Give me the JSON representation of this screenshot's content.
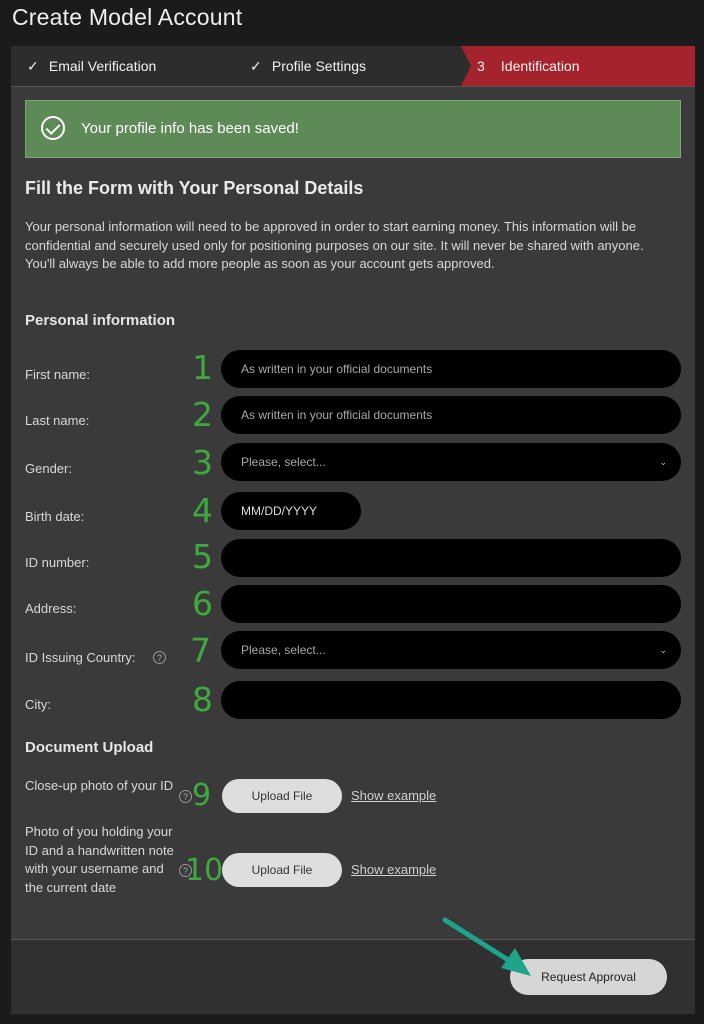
{
  "page_title": "Create Model Account",
  "steps": [
    {
      "label": "Email Verification",
      "status": "done",
      "number": ""
    },
    {
      "label": "Profile Settings",
      "status": "done",
      "number": ""
    },
    {
      "label": "Identification",
      "status": "active",
      "number": "3"
    }
  ],
  "alert": {
    "text": "Your profile info has been saved!"
  },
  "form": {
    "title": "Fill the Form with Your Personal Details",
    "desc_1": "Your personal information will need to be approved in order to start earning money. This information will be confidential and securely used only for positioning purposes on our site. It will never be shared with anyone.",
    "desc_2": "You'll always be able to add more people as soon as your account gets approved."
  },
  "personal": {
    "title": "Personal information",
    "first_name": {
      "label": "First name:",
      "placeholder": "As written in your official documents",
      "num": "1"
    },
    "last_name": {
      "label": "Last name:",
      "placeholder": "As written in your official documents",
      "num": "2"
    },
    "gender": {
      "label": "Gender:",
      "value": "Please, select...",
      "num": "3"
    },
    "birth_date": {
      "label": "Birth date:",
      "placeholder": "MM/DD/YYYY",
      "num": "4"
    },
    "id_number": {
      "label": "ID number:",
      "num": "5"
    },
    "address": {
      "label": "Address:",
      "num": "6"
    },
    "id_country": {
      "label": "ID Issuing Country:",
      "value": "Please, select...",
      "num": "7"
    },
    "city": {
      "label": "City:",
      "num": "8"
    }
  },
  "documents": {
    "title": "Document Upload",
    "closeup": {
      "label": "Close-up photo of your ID",
      "num": "9",
      "button": "Upload File",
      "example": "Show example"
    },
    "holding": {
      "label": "Photo of you holding your ID and a handwritten note with your username and the current date",
      "num": "10",
      "button": "Upload File",
      "example": "Show example"
    }
  },
  "actions": {
    "request_approval": "Request Approval"
  },
  "colors": {
    "active_step": "#a4232c",
    "success": "#5e8a57",
    "annotation": "#3fa83f",
    "arrow": "#1fa38a"
  }
}
